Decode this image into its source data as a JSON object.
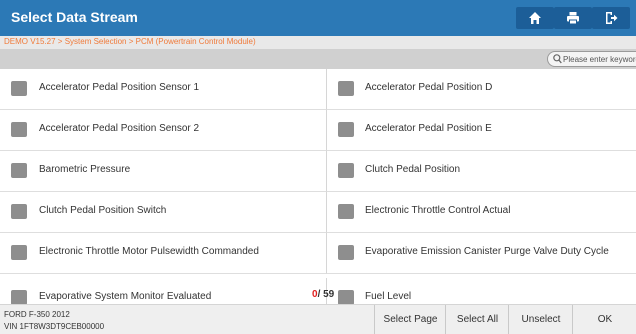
{
  "header": {
    "title": "Select Data Stream",
    "buttons": [
      {
        "icon": "home-icon"
      },
      {
        "icon": "print-icon"
      },
      {
        "icon": "exit-icon"
      }
    ]
  },
  "breadcrumb": "DEMO V15.27 > System Selection > PCM (Powertrain Control Module)",
  "search": {
    "placeholder": "Please enter keyword"
  },
  "items": [
    [
      "Accelerator Pedal Position Sensor 1",
      "Accelerator Pedal Position D"
    ],
    [
      "Accelerator Pedal Position Sensor 2",
      "Accelerator Pedal Position E"
    ],
    [
      "Barometric Pressure",
      "Clutch Pedal Position"
    ],
    [
      "Clutch Pedal Position Switch",
      "Electronic Throttle Control Actual"
    ],
    [
      "Electronic Throttle Motor Pulsewidth Commanded",
      "Evaporative Emission Canister Purge Valve Duty Cycle"
    ],
    [
      "Evaporative System Monitor Evaluated",
      "Fuel Level"
    ]
  ],
  "counter": {
    "selected": "0",
    "total": "/ 59"
  },
  "vehicle": {
    "model": "FORD F-350 2012",
    "vin": "VIN 1FT8W3DT9CEB00000"
  },
  "footer_buttons": {
    "select_page": "Select Page",
    "select_all": "Select All",
    "unselect": "Unselect",
    "ok": "OK"
  },
  "colors": {
    "titlebar": "#2c79b6",
    "titlebar_button": "#1c5e98",
    "breadcrumb_text": "#f07a3a",
    "checkbox": "#8e8e8e",
    "counter_selected": "#e02020"
  }
}
